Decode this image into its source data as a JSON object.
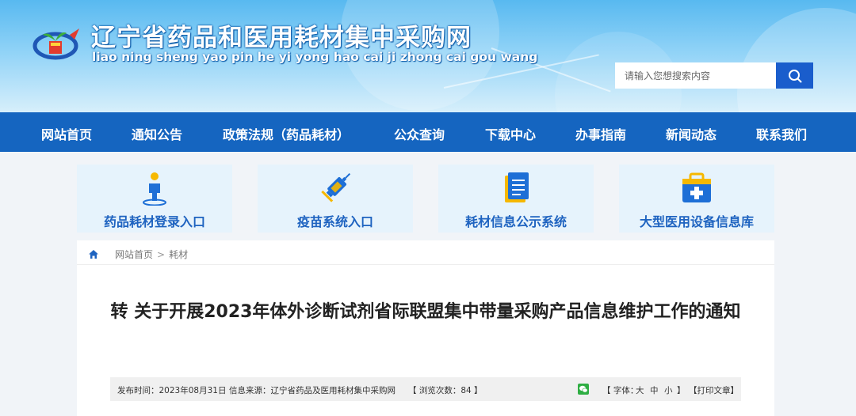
{
  "header": {
    "title": "辽宁省药品和医用耗材集中采购网",
    "pinyin": "liao ning sheng yao pin he yi yong hao cai ji zhong cai gou wang"
  },
  "search": {
    "placeholder": "请输入您想搜索内容"
  },
  "nav": {
    "items": [
      "网站首页",
      "通知公告",
      "政策法规（药品耗材）",
      "公众查询",
      "下载中心",
      "办事指南",
      "新闻动态",
      "联系我们"
    ]
  },
  "tiles": [
    {
      "label": "药品耗材登录入口",
      "icon": "person-icon"
    },
    {
      "label": "疫苗系统入口",
      "icon": "syringe-icon"
    },
    {
      "label": "耗材信息公示系统",
      "icon": "document-icon"
    },
    {
      "label": "大型医用设备信息库",
      "icon": "medical-kit-icon"
    }
  ],
  "breadcrumb": {
    "home": "网站首页",
    "separator": ">",
    "current": "耗材"
  },
  "article": {
    "title": "转 关于开展2023年体外诊断试剂省际联盟集中带量采购产品信息维护工作的通知",
    "meta": {
      "published": "发布时间：2023年08月31日",
      "source": "信息来源：辽宁省药品及医用耗材集中采购网",
      "views": "【 浏览次数：84 】",
      "font_label": "【 字体：",
      "font_large": "大",
      "font_medium": "中",
      "font_small": "小",
      "font_close": "】",
      "print": "【打印文章】"
    }
  },
  "colors": {
    "nav_bg": "#1565c0",
    "tile_bg": "#e6f3fc",
    "tile_text": "#1e63c0",
    "search_btn": "#1a5dcc"
  }
}
